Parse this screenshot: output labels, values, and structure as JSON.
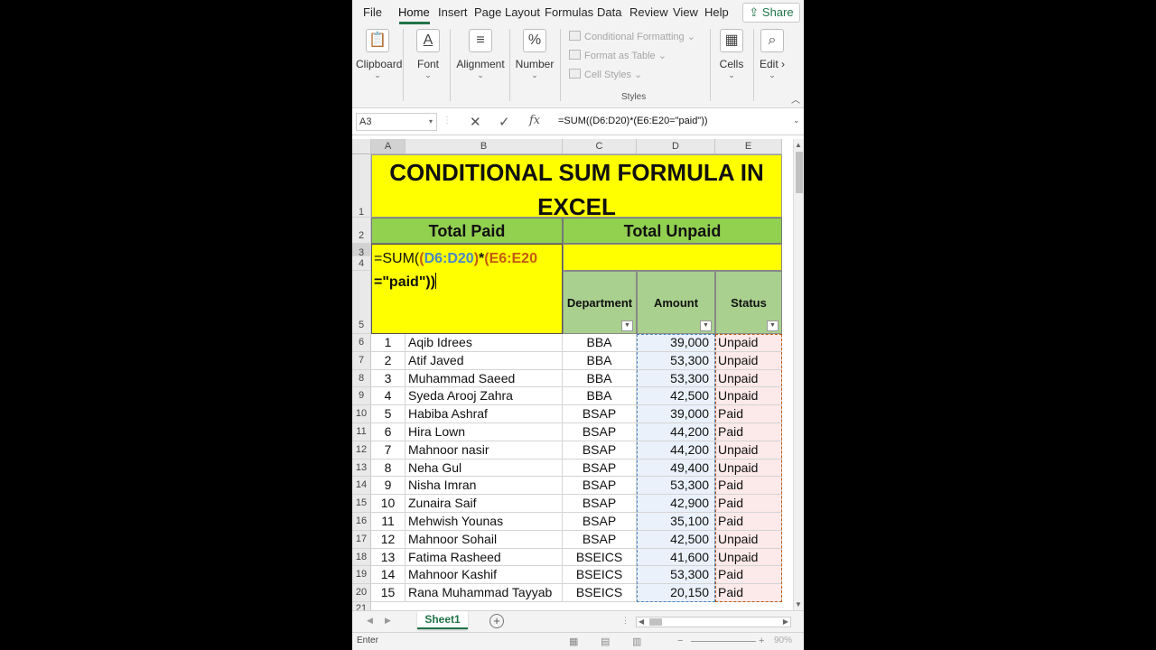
{
  "ribbon_tabs": [
    "File",
    "Home",
    "Insert",
    "Page Layout",
    "Formulas",
    "Data",
    "Review",
    "View",
    "Help"
  ],
  "share_label": "Share",
  "groups": {
    "clipboard": "Clipboard",
    "font": "Font",
    "alignment": "Alignment",
    "number": "Number",
    "cells": "Cells",
    "editing": "Edit"
  },
  "styles": {
    "conditional": "Conditional Formatting",
    "table": "Format as Table",
    "cell_styles": "Cell Styles",
    "label": "Styles"
  },
  "formula_bar": {
    "name_box": "A3",
    "fx": "fx",
    "formula": "=SUM((D6:D20)*(E6:E20=\"paid\"))"
  },
  "columns": [
    "A",
    "B",
    "C",
    "D",
    "E"
  ],
  "row_numbers": [
    "1",
    "2",
    "3",
    "4",
    "5",
    "6",
    "7",
    "8",
    "9",
    "10",
    "11",
    "12",
    "13",
    "14",
    "15",
    "16",
    "17",
    "18",
    "19",
    "20",
    "21"
  ],
  "title_line1": "CONDITIONAL SUM FORMULA IN",
  "title_line2": "EXCEL",
  "total_paid": "Total Paid",
  "total_unpaid": "Total Unpaid",
  "edit_formula": {
    "p1": "=SUM(",
    "p2": "(",
    "p3": "D6:D20",
    "p4": ")",
    "p5": "*",
    "p6": "(E6:E20",
    "p7": "=\"paid\"",
    "p8": "))"
  },
  "table_headers": {
    "department": "Department",
    "amount": "Amount",
    "status": "Status"
  },
  "rows": [
    {
      "no": "1",
      "name": "Aqib Idrees",
      "dept": "BBA",
      "amount": "39,000",
      "status": "Unpaid"
    },
    {
      "no": "2",
      "name": "Atif Javed",
      "dept": "BBA",
      "amount": "53,300",
      "status": "Unpaid"
    },
    {
      "no": "3",
      "name": "Muhammad Saeed",
      "dept": "BBA",
      "amount": "53,300",
      "status": "Unpaid"
    },
    {
      "no": "4",
      "name": "Syeda Arooj Zahra",
      "dept": "BBA",
      "amount": "42,500",
      "status": "Unpaid"
    },
    {
      "no": "5",
      "name": "Habiba Ashraf",
      "dept": "BSAP",
      "amount": "39,000",
      "status": "Paid"
    },
    {
      "no": "6",
      "name": "Hira Lown",
      "dept": "BSAP",
      "amount": "44,200",
      "status": "Paid"
    },
    {
      "no": "7",
      "name": "Mahnoor nasir",
      "dept": "BSAP",
      "amount": "44,200",
      "status": "Unpaid"
    },
    {
      "no": "8",
      "name": "Neha Gul",
      "dept": "BSAP",
      "amount": "49,400",
      "status": "Unpaid"
    },
    {
      "no": "9",
      "name": "Nisha Imran",
      "dept": "BSAP",
      "amount": "53,300",
      "status": "Paid"
    },
    {
      "no": "10",
      "name": "Zunaira Saif",
      "dept": "BSAP",
      "amount": "42,900",
      "status": "Paid"
    },
    {
      "no": "11",
      "name": "Mehwish Younas",
      "dept": "BSAP",
      "amount": "35,100",
      "status": "Paid"
    },
    {
      "no": "12",
      "name": "Mahnoor Sohail",
      "dept": "BSAP",
      "amount": "42,500",
      "status": "Unpaid"
    },
    {
      "no": "13",
      "name": "Fatima Rasheed",
      "dept": "BSEICS",
      "amount": "41,600",
      "status": "Unpaid"
    },
    {
      "no": "14",
      "name": "Mahnoor Kashif",
      "dept": "BSEICS",
      "amount": "53,300",
      "status": "Paid"
    },
    {
      "no": "15",
      "name": "Rana Muhammad Tayyab",
      "dept": "BSEICS",
      "amount": "20,150",
      "status": "Paid"
    }
  ],
  "sheet_tab": "Sheet1",
  "status_text": "Enter",
  "zoom": "90%",
  "colors": {
    "accent": "#217346",
    "title_fill": "#ffff00",
    "header_green": "#92d050",
    "table_header": "#a9d08e",
    "range_blue": "#4a86c5",
    "range_orange": "#c55a11"
  }
}
